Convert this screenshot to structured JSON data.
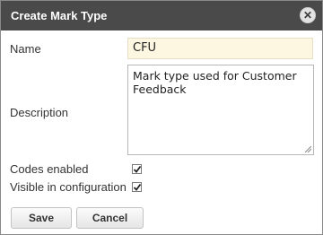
{
  "dialog": {
    "title": "Create Mark Type",
    "close_icon": "close-icon"
  },
  "form": {
    "name_label": "Name",
    "name_value": "CFU",
    "description_label": "Description",
    "description_value": "Mark type used for Customer Feedback",
    "codes_enabled_label": "Codes enabled",
    "codes_enabled_checked": true,
    "visible_in_configuration_label": "Visible in configuration",
    "visible_in_configuration_checked": true
  },
  "buttons": {
    "save_label": "Save",
    "cancel_label": "Cancel"
  }
}
